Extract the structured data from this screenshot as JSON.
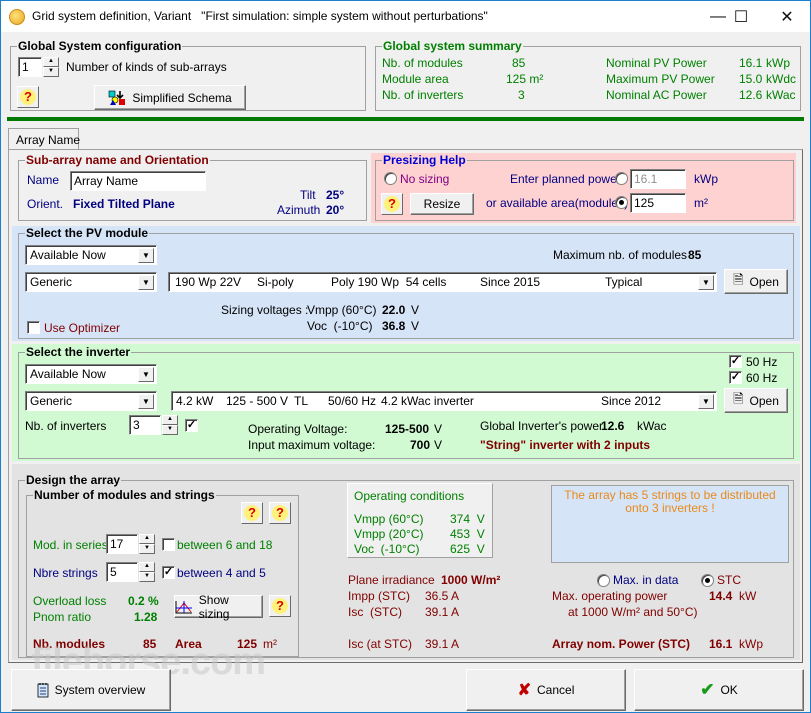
{
  "window": {
    "title": "Grid system definition, Variant   \"First simulation: simple system without perturbations\"",
    "minimize": "—",
    "maximize": "☐",
    "close": "✕"
  },
  "global_config": {
    "title": "Global System configuration",
    "kinds_value": "1",
    "kinds_label": "Number of kinds of sub-arrays",
    "schema_button": "Simplified Schema"
  },
  "summary": {
    "title": "Global system summary",
    "rows_left": [
      {
        "label": "Nb. of modules",
        "value": "85"
      },
      {
        "label": "Module area",
        "value": "125 m²"
      },
      {
        "label": "Nb. of inverters",
        "value": "3"
      }
    ],
    "rows_right": [
      {
        "label": "Nominal PV Power",
        "value": "16.1",
        "unit": "kWp"
      },
      {
        "label": "Maximum PV Power",
        "value": "15.0",
        "unit": "kWdc"
      },
      {
        "label": "Nominal AC Power",
        "value": "12.6",
        "unit": "kWac"
      }
    ],
    "accent_color": "#008000"
  },
  "tab": {
    "label": "Array Name"
  },
  "orientation": {
    "title": "Sub-array name and Orientation",
    "name_label": "Name",
    "name_value": "Array Name",
    "orient_label": "Orient.",
    "orient_value": "Fixed Tilted Plane",
    "tilt_label": "Tilt",
    "tilt_value": "25°",
    "azimuth_label": "Azimuth",
    "azimuth_value": "20°"
  },
  "presizing": {
    "title": "Presizing Help",
    "no_sizing": "No sizing",
    "planned_power_label": "Enter planned power",
    "planned_power_value": "16.1",
    "planned_power_unit": "kWp",
    "area_label": "or available area(modules)",
    "area_value": "125",
    "area_unit": "m²",
    "resize_button": "Resize",
    "selected": "area"
  },
  "pv_module": {
    "title": "Select the PV module",
    "availability": "Available Now",
    "manufacturer": "Generic",
    "model": {
      "power": "190 Wp 22V",
      "tech": "Si-poly",
      "name": "Poly 190 Wp  54 cells",
      "since": "Since 2015",
      "type": "Typical"
    },
    "open_button": "Open",
    "max_modules_label": "Maximum nb. of modules",
    "max_modules_value": "85",
    "sizing_label": "Sizing voltages :",
    "vmpp_label": "Vmpp (60°C)",
    "vmpp_value": "22.0",
    "voc_label": "Voc  (-10°C)",
    "voc_value": "36.8",
    "volt_unit": "V",
    "optimizer_label": "Use Optimizer"
  },
  "inverter": {
    "title": "Select the inverter",
    "availability": "Available Now",
    "manufacturer": "Generic",
    "model": {
      "power": "4.2 kW",
      "range": "125 - 500 V",
      "type": "TL",
      "freq": "50/60 Hz",
      "name": "4.2 kWac inverter",
      "since": "Since 2012"
    },
    "hz50": "50 Hz",
    "hz60": "60 Hz",
    "open_button": "Open",
    "nb_label": "Nb. of inverters",
    "nb_value": "3",
    "op_voltage_label": "Operating Voltage:",
    "op_voltage_value": "125-500",
    "max_voltage_label": "Input maximum voltage:",
    "max_voltage_value": "700",
    "volt_unit": "V",
    "global_power_label": "Global Inverter's power",
    "global_power_value": "12.6",
    "global_power_unit": "kWac",
    "string_note": "\"String\" inverter with 2 inputs"
  },
  "design": {
    "title": "Design the array",
    "sub_title": "Number of modules and strings",
    "series_label": "Mod. in series",
    "series_value": "17",
    "series_range": "between 6 and 18",
    "strings_label": "Nbre strings",
    "strings_value": "5",
    "strings_range": "between 4 and 5",
    "overload_label": "Overload loss",
    "overload_value": "0.2 %",
    "pnom_label": "Pnom ratio",
    "pnom_value": "1.28",
    "show_sizing": "Show sizing",
    "nb_modules_label": "Nb. modules",
    "nb_modules_value": "85",
    "area_label": "Area",
    "area_value": "125",
    "area_unit": "m²",
    "op_conditions": {
      "title": "Operating conditions",
      "rows": [
        {
          "label": "Vmpp (60°C)",
          "value": "374  V"
        },
        {
          "label": "Vmpp (20°C)",
          "value": "453  V"
        },
        {
          "label": "Voc  (-10°C)",
          "value": "625  V"
        }
      ]
    },
    "irradiance_label": "Plane irradiance",
    "irradiance_value": "1000 W/m²",
    "impp_label": "Impp (STC)",
    "impp_value": "36.5 A",
    "isc_label": "Isc  (STC)",
    "isc_value": "39.1 A",
    "isc_at_label": "Isc (at STC)",
    "isc_at_value": "39.1 A",
    "message": "The array has 5 strings to be distributed onto 3 inverters !",
    "max_in_data": "Max. in data",
    "stc": "STC",
    "max_op_label": "Max. operating power",
    "max_op_sub": "at 1000 W/m² and 50°C)",
    "max_op_value": "14.4",
    "max_op_unit": "kW",
    "nom_power_label": "Array nom. Power (STC)",
    "nom_power_value": "16.1",
    "nom_power_unit": "kWp"
  },
  "footer": {
    "overview_button": "System overview",
    "cancel_button": "Cancel",
    "ok_button": "OK",
    "watermark": "filehorse.com"
  }
}
